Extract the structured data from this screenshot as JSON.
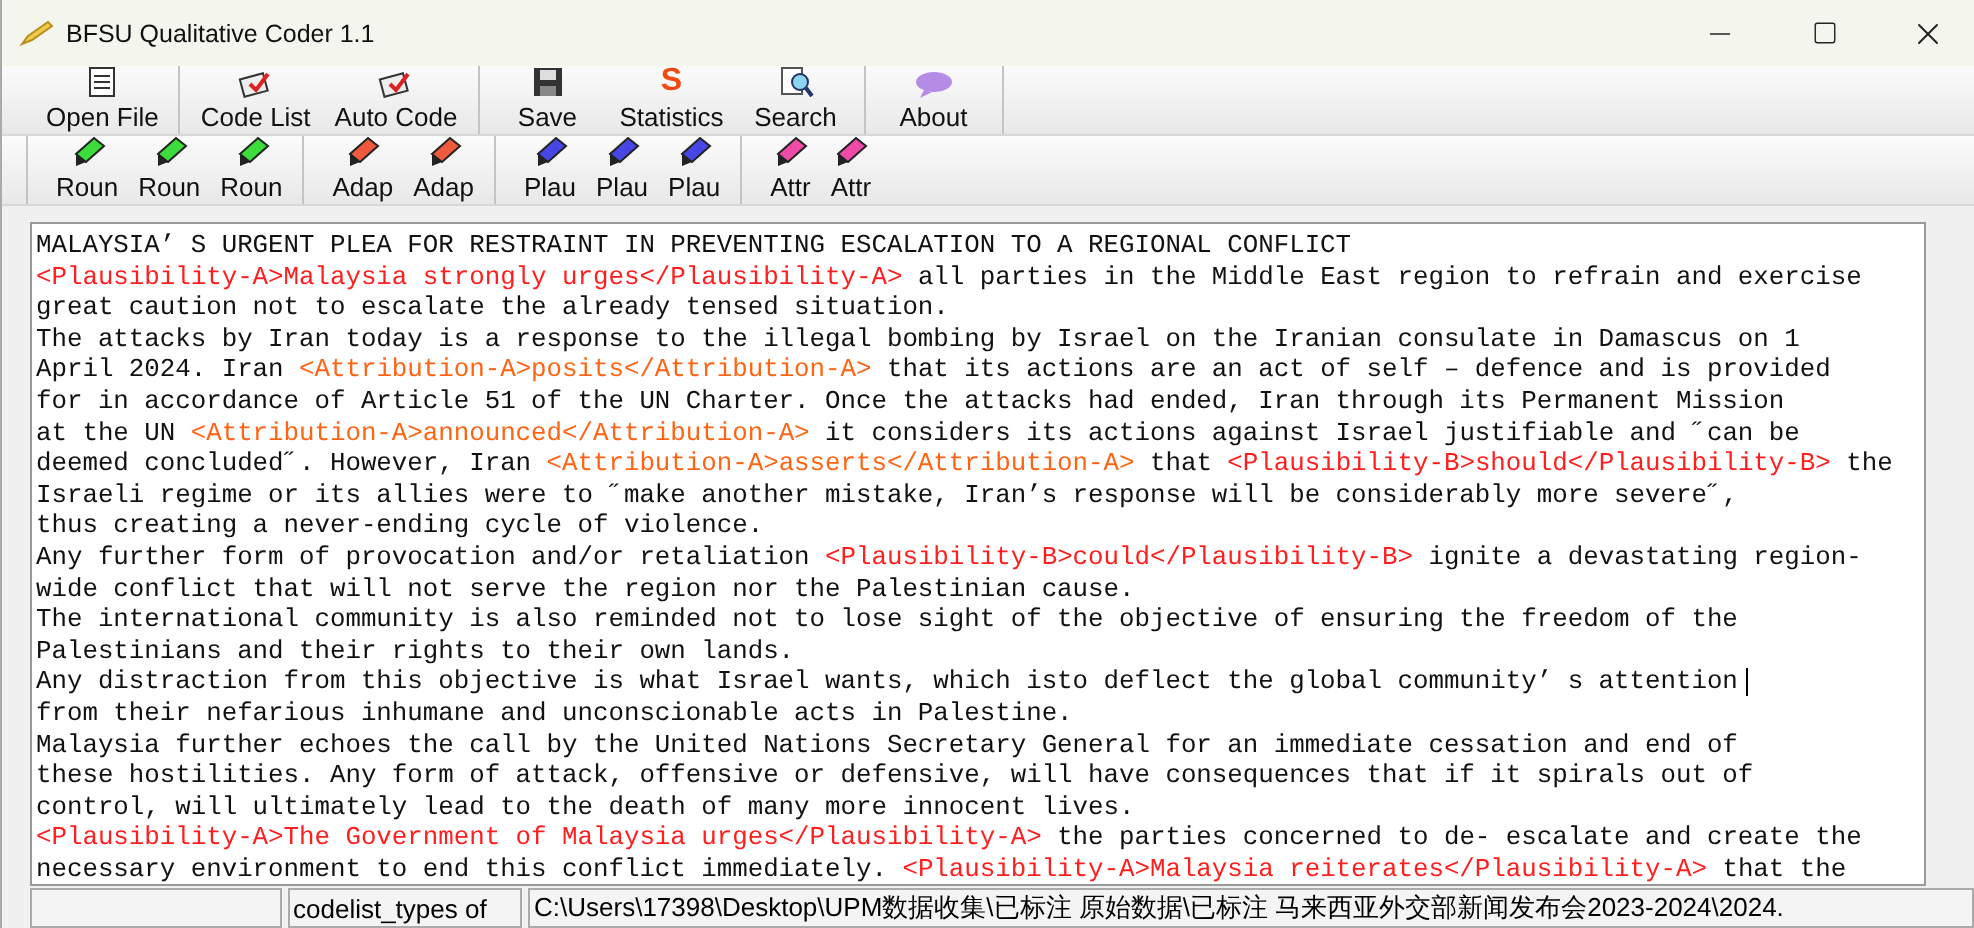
{
  "window": {
    "title": "BFSU Qualitative Coder 1.1"
  },
  "toolbar": [
    [
      {
        "label": "Open File"
      }
    ],
    [
      {
        "label": "Code List"
      },
      {
        "label": "Auto Code"
      }
    ],
    [
      {
        "label": "Save"
      },
      {
        "label": "Statistics"
      },
      {
        "label": "Search"
      }
    ],
    [
      {
        "label": "About"
      }
    ]
  ],
  "statistics_glyph": "S",
  "code_buttons": [
    [
      {
        "label": "Roun",
        "color": "#3cdc3c"
      },
      {
        "label": "Roun",
        "color": "#3cdc3c"
      },
      {
        "label": "Roun",
        "color": "#3cdc3c"
      }
    ],
    [
      {
        "label": "Adap",
        "color": "#f05a3c"
      },
      {
        "label": "Adap",
        "color": "#f05a3c"
      }
    ],
    [
      {
        "label": "Plau",
        "color": "#4646e6"
      },
      {
        "label": "Plau",
        "color": "#4646e6"
      },
      {
        "label": "Plau",
        "color": "#4646e6"
      }
    ],
    [
      {
        "label": "Attr",
        "color": "#ee4aa8"
      },
      {
        "label": "Attr",
        "color": "#ee4aa8"
      }
    ]
  ],
  "document_lines": [
    [
      {
        "text": "MALAYSIA’ S URGENT PLEA FOR RESTRAINT IN PREVENTING ESCALATION TO A REGIONAL CONFLICT"
      }
    ],
    [
      {
        "text": "<Plausibility-A>Malaysia strongly urges</Plausibility-A>",
        "color": "#ff1e1e"
      },
      {
        "text": " all parties in the Middle East region to refrain and exercise"
      }
    ],
    [
      {
        "text": "great caution not to escalate the already tensed situation."
      }
    ],
    [
      {
        "text": "The attacks by Iran today is a response to the illegal bombing by Israel on the Iranian consulate in Damascus on 1"
      }
    ],
    [
      {
        "text": "April 2024. Iran "
      },
      {
        "text": "<Attribution-A>posits</Attribution-A>",
        "color": "#ff6414"
      },
      {
        "text": " that its actions are an act of self – defence and is provided"
      }
    ],
    [
      {
        "text": "for in accordance of Article 51 of the UN Charter. Once the attacks had ended, Iran through its Permanent Mission"
      }
    ],
    [
      {
        "text": "at the UN "
      },
      {
        "text": "<Attribution-A>announced</Attribution-A>",
        "color": "#ff6414"
      },
      {
        "text": " it considers its actions against Israel justifiable and ˝can be"
      }
    ],
    [
      {
        "text": "deemed concluded˝. However, Iran "
      },
      {
        "text": "<Attribution-A>asserts</Attribution-A>",
        "color": "#ff6414"
      },
      {
        "text": " that "
      },
      {
        "text": "<Plausibility-B>should</Plausibility-B>",
        "color": "#ff1e1e"
      },
      {
        "text": " the"
      }
    ],
    [
      {
        "text": "Israeli regime or its allies were to ˝make another mistake, Iran’s response will be considerably more severe˝,"
      }
    ],
    [
      {
        "text": "thus creating a never-ending cycle of violence."
      }
    ],
    [
      {
        "text": "Any further form of provocation and/or retaliation "
      },
      {
        "text": "<Plausibility-B>could</Plausibility-B>",
        "color": "#ff1e1e"
      },
      {
        "text": " ignite a devastating region-"
      }
    ],
    [
      {
        "text": "wide conflict that will not serve the region nor the Palestinian cause."
      }
    ],
    [
      {
        "text": "The international community is also reminded not to lose sight of the objective of ensuring the freedom of the"
      }
    ],
    [
      {
        "text": "Palestinians and their rights to their own lands."
      }
    ],
    [
      {
        "text": "Any distraction from this objective is what Israel wants, which isto deflect the global community’ s attention"
      },
      {
        "kind": "caret"
      }
    ],
    [
      {
        "text": "from their nefarious inhumane and unconscionable acts in Palestine."
      }
    ],
    [
      {
        "text": "Malaysia further echoes the call by the United Nations Secretary General for an immediate cessation and end of"
      }
    ],
    [
      {
        "text": "these hostilities. Any form of attack, offensive or defensive, will have consequences that if it spirals out of"
      }
    ],
    [
      {
        "text": "control, will ultimately lead to the death of many more innocent lives."
      }
    ],
    [
      {
        "text": "<Plausibility-A>The Government of Malaysia urges</Plausibility-A>",
        "color": "#ff1e1e"
      },
      {
        "text": " the parties concerned to de- escalate and create the"
      }
    ],
    [
      {
        "text": "necessary environment to end this conflict immediately. "
      },
      {
        "text": "<Plausibility-A>Malaysia reiterates</Plausibility-A>",
        "color": "#ff1e1e"
      },
      {
        "text": " that the"
      }
    ]
  ],
  "status_bar": {
    "panel_2": "codelist_types of",
    "path": "C:\\Users\\17398\\Desktop\\UPM数据收集\\已标注 原始数据\\已标注 马来西亚外交部新闻发布会2023-2024\\2024."
  }
}
